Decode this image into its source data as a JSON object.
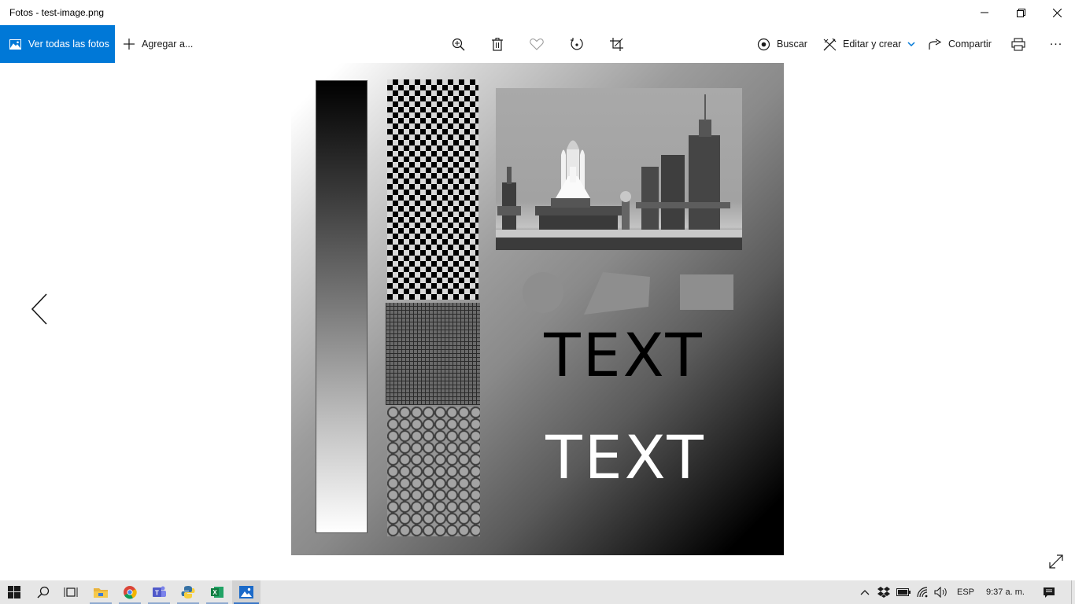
{
  "window": {
    "title": "Fotos - test-image.png"
  },
  "toolbar": {
    "view_all_label": "Ver todas las fotos",
    "add_label": "Agregar a...",
    "search_label": "Buscar",
    "edit_create_label": "Editar y crear",
    "share_label": "Compartir",
    "more_label": "..."
  },
  "image": {
    "text_black": "TEXT",
    "text_white": "TEXT"
  },
  "taskbar": {
    "language": "ESP",
    "clock": "9:37 a. m."
  },
  "colors": {
    "accent": "#0078d7",
    "taskbar": "#e6e6e6"
  },
  "icons": [
    "windows-start-icon",
    "search-icon",
    "task-view-icon",
    "file-explorer-icon",
    "chrome-icon",
    "teams-icon",
    "python-icon",
    "excel-icon",
    "photos-icon",
    "chevron-up-icon",
    "dropbox-icon",
    "battery-icon",
    "wifi-icon",
    "volume-icon",
    "notifications-icon"
  ]
}
